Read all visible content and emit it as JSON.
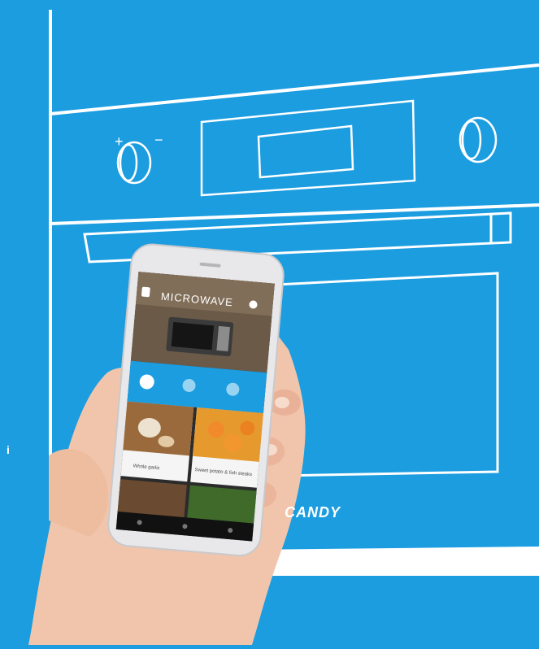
{
  "scene": {
    "background_color": "#1b9de0",
    "line_color": "#ffffff",
    "hand_color": "#f2c7ae"
  },
  "oven": {
    "knob_left_plus": "+",
    "knob_left_minus": "−",
    "brand": "CANDY"
  },
  "phone": {
    "screen_title": "MICROWAVE",
    "card_1_label": "Whole garlic",
    "card_2_label": "Sweet potato & fish steaks"
  },
  "edge_text": "i"
}
